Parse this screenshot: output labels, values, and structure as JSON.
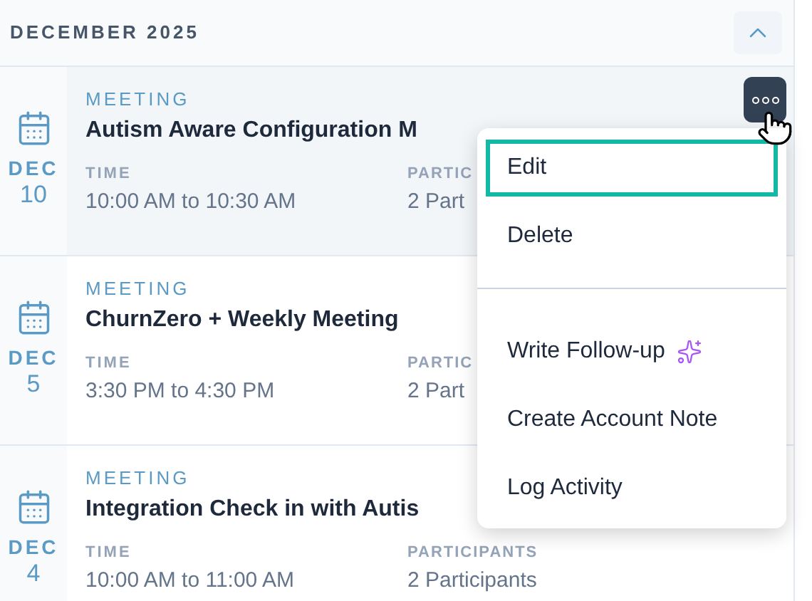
{
  "section": {
    "title": "DECEMBER 2025",
    "expanded": true
  },
  "events": [
    {
      "type": "MEETING",
      "title": "Autism Aware Configuration M",
      "month": "DEC",
      "day": "10",
      "time_label": "TIME",
      "time": "10:00 AM to 10:30 AM",
      "participants_label": "PARTIC",
      "participants": "2 Part",
      "hovered": true
    },
    {
      "type": "MEETING",
      "title": "ChurnZero + Weekly Meeting",
      "month": "DEC",
      "day": "5",
      "time_label": "TIME",
      "time": "3:30 PM to 4:30 PM",
      "participants_label": "PARTIC",
      "participants": "2 Part",
      "hovered": false
    },
    {
      "type": "MEETING",
      "title": "Integration Check in with Autis",
      "month": "DEC",
      "day": "4",
      "time_label": "TIME",
      "time": "10:00 AM to 11:00 AM",
      "participants_label": "PARTICIPANTS",
      "participants": "2 Participants",
      "hovered": false
    }
  ],
  "menu": {
    "items": [
      {
        "kind": "item",
        "label": "Edit",
        "selected": true
      },
      {
        "kind": "item",
        "label": "Delete",
        "selected": false
      },
      {
        "kind": "divider"
      },
      {
        "kind": "ai",
        "label": "Write Follow-up",
        "selected": false
      },
      {
        "kind": "item",
        "label": "Create Account Note",
        "selected": false
      },
      {
        "kind": "item",
        "label": "Log Activity",
        "selected": false
      }
    ]
  }
}
